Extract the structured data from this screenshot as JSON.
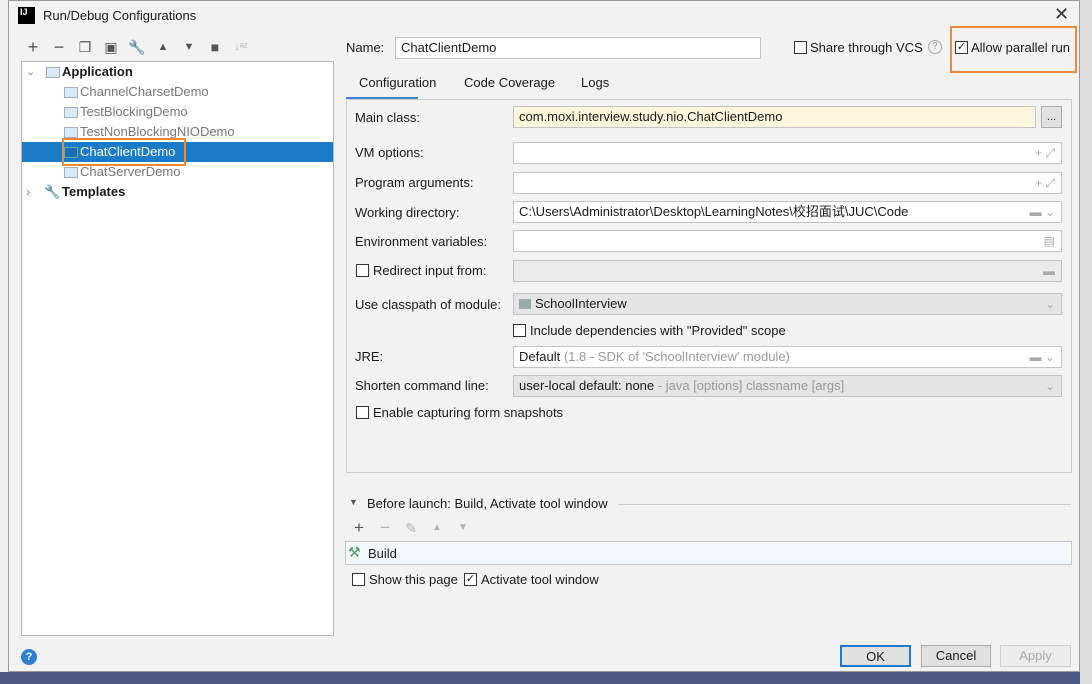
{
  "window": {
    "title": "Run/Debug Configurations",
    "app_icon": "intellij-icon",
    "close_icon": "close-icon"
  },
  "toolbar": {
    "icons": [
      "plus-icon",
      "minus-icon",
      "copy-icon",
      "save-icon",
      "wrench-icon",
      "arrow-up-icon",
      "arrow-down-icon",
      "new-folder-icon",
      "sort-az-icon"
    ]
  },
  "tree": {
    "application": "Application",
    "items": [
      "ChannelCharsetDemo",
      "TestBlockingDemo",
      "TestNonBlockingNIODemo",
      "ChatClientDemo",
      "ChatServerDemo"
    ],
    "selected": "ChatClientDemo",
    "templates": "Templates"
  },
  "header": {
    "name_label": "Name:",
    "name_value": "ChatClientDemo",
    "share_vcs": "Share through VCS",
    "share_vcs_checked": false,
    "allow_parallel": "Allow parallel run",
    "allow_parallel_checked": true
  },
  "tabs": [
    {
      "label": "Configuration",
      "active": true
    },
    {
      "label": "Code Coverage"
    },
    {
      "label": "Logs"
    }
  ],
  "form": {
    "main_class_label": "Main class:",
    "main_class_value": "com.moxi.interview.study.nio.ChatClientDemo",
    "browse": "...",
    "vm_label": "VM options:",
    "vm_value": "",
    "args_label": "Program arguments:",
    "args_value": "",
    "workdir_label": "Working directory:",
    "workdir_value": "C:\\Users\\Administrator\\Desktop\\LearningNotes\\校招面试\\JUC\\Code",
    "env_label": "Environment variables:",
    "env_value": "",
    "redirect_label": "Redirect input from:",
    "redirect_checked": false,
    "module_label": "Use classpath of module:",
    "module_value": "SchoolInterview",
    "include_deps": "Include dependencies with \"Provided\" scope",
    "include_deps_checked": false,
    "jre_label": "JRE:",
    "jre_value": "Default",
    "jre_hint": "(1.8 - SDK of 'SchoolInterview' module)",
    "shorten_label": "Shorten command line:",
    "shorten_value": "user-local default: none",
    "shorten_hint": "- java [options] classname [args]",
    "snapshots": "Enable capturing form snapshots",
    "snapshots_checked": false
  },
  "before_launch": {
    "title": "Before launch: Build, Activate tool window",
    "items": [
      "Build"
    ],
    "show_page": "Show this page",
    "show_page_checked": false,
    "activate": "Activate tool window",
    "activate_checked": true
  },
  "buttons": {
    "ok": "OK",
    "cancel": "Cancel",
    "apply": "Apply"
  },
  "colors": {
    "selection": "#1a7bc9",
    "highlight_box": "#f08a3a",
    "main_class_bg": "#fdf6dc"
  }
}
